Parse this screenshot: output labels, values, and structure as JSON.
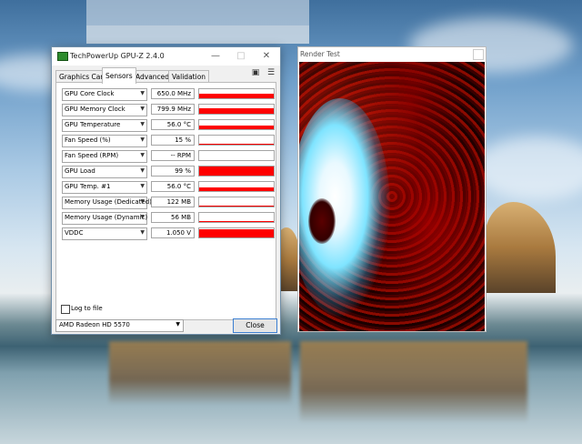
{
  "gpuz": {
    "title": "TechPowerUp GPU-Z 2.4.0",
    "tabs": [
      "Graphics Card",
      "Sensors",
      "Advanced",
      "Validation"
    ],
    "active_tab": "Sensors",
    "sensors": [
      {
        "label": "GPU Core Clock",
        "value": "650.0 MHz",
        "level": 0.55
      },
      {
        "label": "GPU Memory Clock",
        "value": "799.9 MHz",
        "level": 0.6
      },
      {
        "label": "GPU Temperature",
        "value": "56.0 °C",
        "level": 0.4
      },
      {
        "label": "Fan Speed (%)",
        "value": "15 %",
        "level": 0.12
      },
      {
        "label": "Fan Speed (RPM)",
        "value": "-- RPM",
        "level": 0
      },
      {
        "label": "GPU Load",
        "value": "99 %",
        "level": 0.99
      },
      {
        "label": "GPU Temp. #1",
        "value": "56.0 °C",
        "level": 0.4
      },
      {
        "label": "Memory Usage (Dedicated)",
        "value": "122 MB",
        "level": 0.12
      },
      {
        "label": "Memory Usage (Dynamic)",
        "value": "56 MB",
        "level": 0.08
      },
      {
        "label": "VDDC",
        "value": "1.050 V",
        "level": 0.95
      }
    ],
    "log_to_file_label": "Log to file",
    "log_to_file_checked": false,
    "gpu_selected": "AMD Radeon HD 5570",
    "close_label": "Close",
    "graph_color": "#ff0000"
  },
  "render_test": {
    "title": "Render Test"
  }
}
